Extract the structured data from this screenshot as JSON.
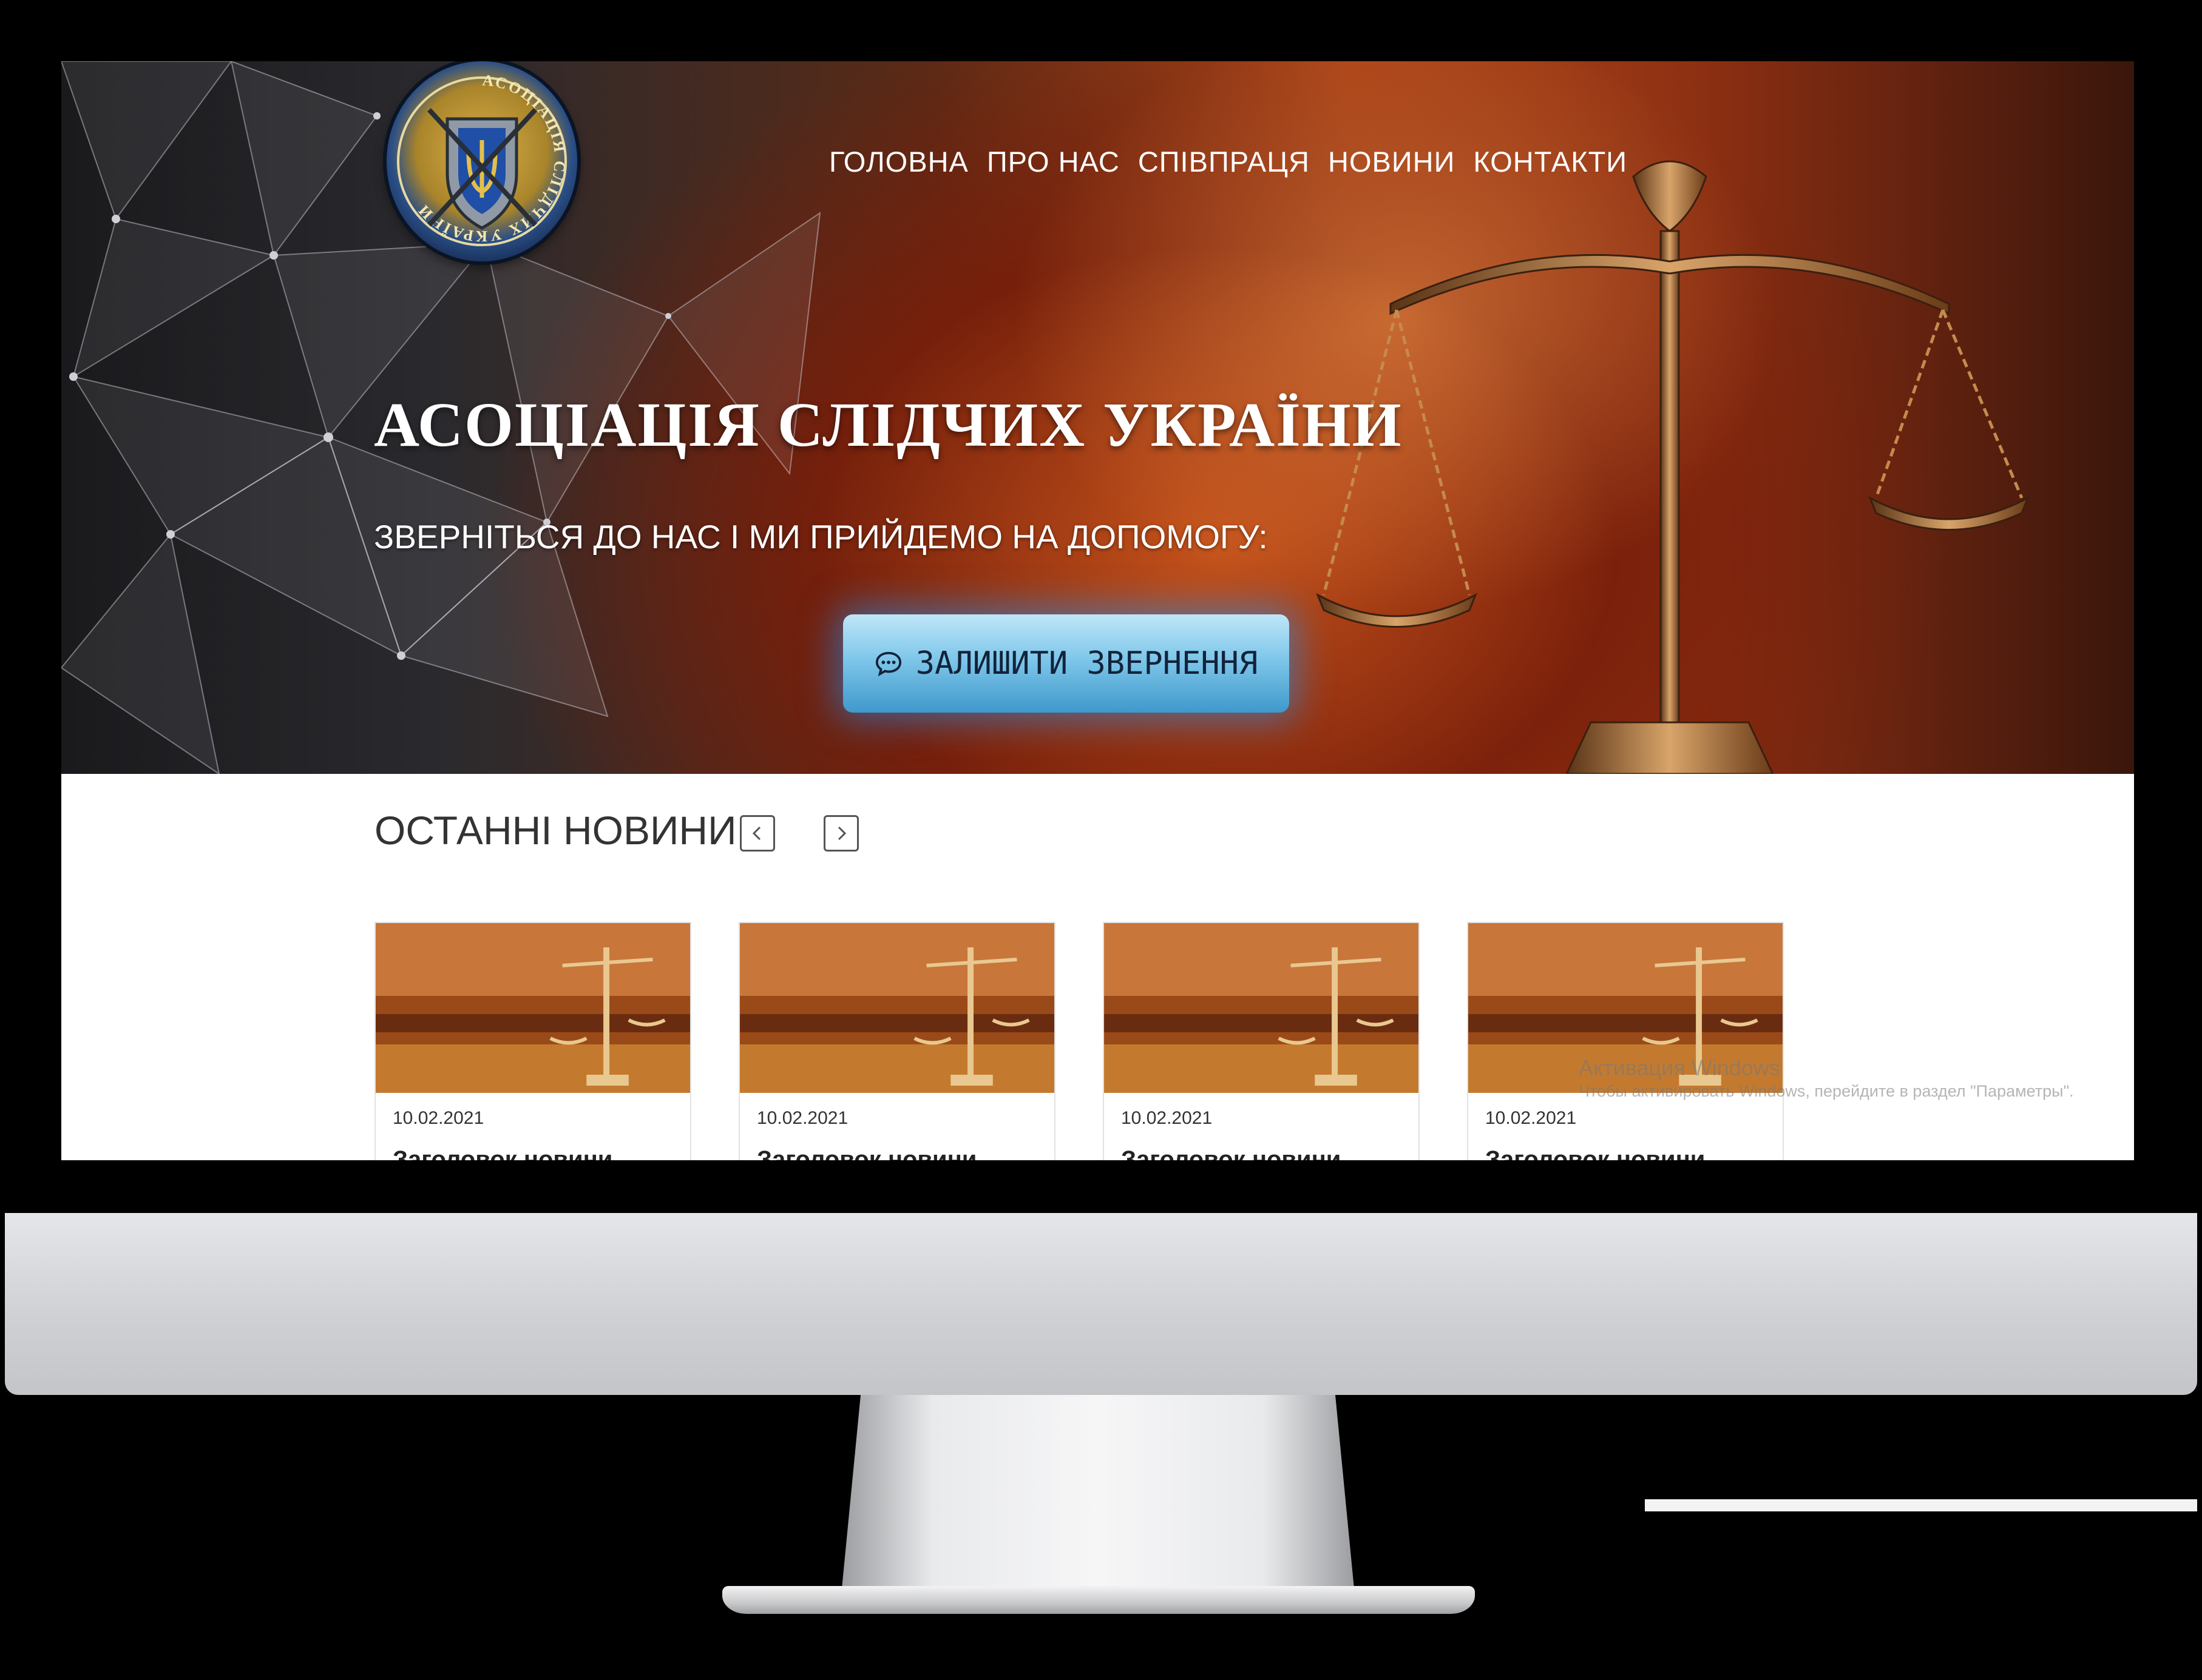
{
  "nav": {
    "items": [
      "ГОЛОВНА",
      "ПРО НАС",
      "СПІВПРАЦЯ",
      "НОВИНИ",
      "КОНТАКТИ"
    ]
  },
  "hero": {
    "title": "АСОЦІАЦІЯ СЛІДЧИХ УКРАЇНИ",
    "subtitle": "ЗВЕРНІТЬСЯ ДО НАС І МИ ПРИЙДЕМО НА ДОПОМОГУ:",
    "cta_label": "ЗАЛИШИТИ ЗВЕРНЕННЯ"
  },
  "logo": {
    "ring_text": "АСОЦІАЦІЯ СЛІДЧИХ УКРАЇНИ"
  },
  "news": {
    "title": "ОСТАННІ НОВИНИ",
    "cards": [
      {
        "date": "10.02.2021",
        "title": "Заголовок новини"
      },
      {
        "date": "10.02.2021",
        "title": "Заголовок новини"
      },
      {
        "date": "10.02.2021",
        "title": "Заголовок новини"
      },
      {
        "date": "10.02.2021",
        "title": "Заголовок новини"
      }
    ]
  },
  "watermark": {
    "line1": "Активация Windows",
    "line2": "Чтобы активировать Windows, перейдите в раздел \"Параметры\"."
  },
  "icons": {
    "cta": "chat-bubble-icon",
    "prev": "chevron-left-icon",
    "next": "chevron-right-icon"
  },
  "colors": {
    "cta_top": "#bfe6f7",
    "cta_bottom": "#3f98cc",
    "hero_warm": "#b54a1a",
    "chin": "#cfd1d4"
  }
}
